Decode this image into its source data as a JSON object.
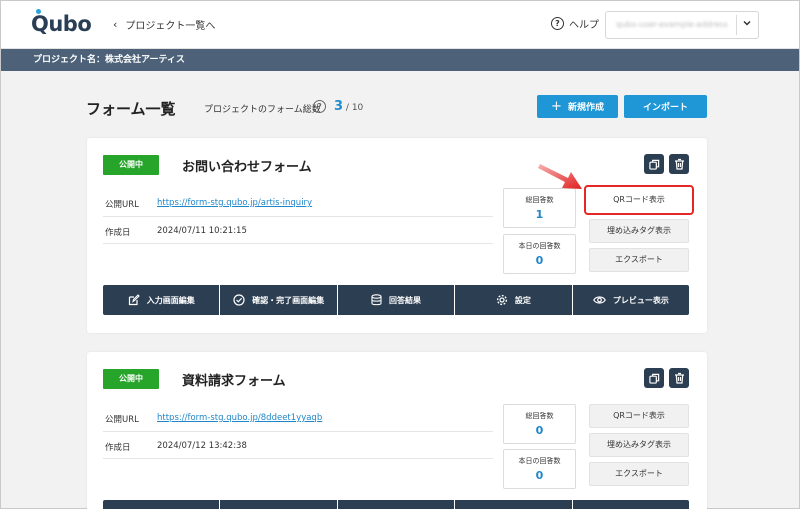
{
  "app": {
    "logo": "Qubo",
    "back_label": "プロジェクト一覧へ",
    "help_label": "ヘルプ",
    "account_email": "qubo-user-example-address"
  },
  "project": {
    "label": "プロジェクト名：株式会社アーティス"
  },
  "page": {
    "title": "フォーム一覧",
    "total_label": "プロジェクトのフォーム総数",
    "count": "3",
    "max": "10",
    "new_button": "新規作成",
    "import_button": "インポート"
  },
  "forms": [
    {
      "status": "公開中",
      "name": "お問い合わせフォーム",
      "url_label": "公開URL",
      "url": "https://form-stg.qubo.jp/artis-inquiry",
      "created_label": "作成日",
      "created": "2024/07/11 10:21:15",
      "total_responses_label": "総回答数",
      "total_responses": "1",
      "today_responses_label": "本日の回答数",
      "today_responses": "0",
      "qr_button": "QRコード表示",
      "embed_button": "埋め込みタグ表示",
      "export_button": "エクスポート"
    },
    {
      "status": "公開中",
      "name": "資料請求フォーム",
      "url_label": "公開URL",
      "url": "https://form-stg.qubo.jp/8ddeet1yyaqb",
      "created_label": "作成日",
      "created": "2024/07/12 13:42:38",
      "total_responses_label": "総回答数",
      "total_responses": "0",
      "today_responses_label": "本日の回答数",
      "today_responses": "0",
      "qr_button": "QRコード表示",
      "embed_button": "埋め込みタグ表示",
      "export_button": "エクスポート"
    }
  ],
  "actions": [
    "入力画面編集",
    "確認・完了画面編集",
    "回答結果",
    "設定",
    "プレビュー表示"
  ],
  "colors": {
    "accent": "#1f97d7",
    "navy": "#2c3e52",
    "status_green": "#26a52a",
    "highlight_red": "#e52727"
  }
}
